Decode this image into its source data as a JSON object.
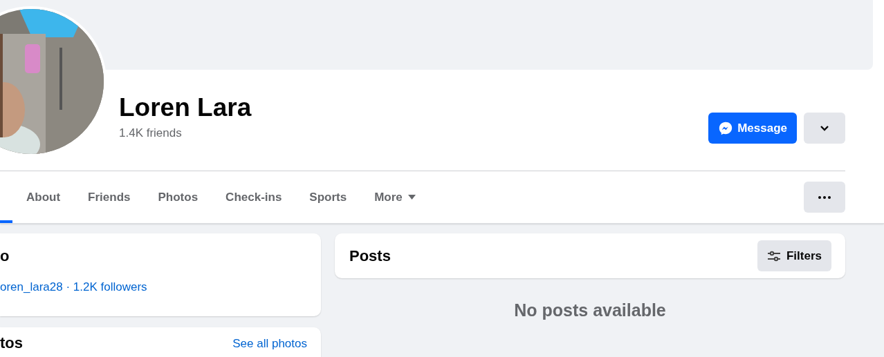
{
  "profile": {
    "name": "Loren Lara",
    "friends": "1.4K friends"
  },
  "actions": {
    "message": "Message"
  },
  "nav": {
    "hidden_tab_selected": true,
    "tabs": [
      {
        "label": "About",
        "selected": false
      },
      {
        "label": "Friends",
        "selected": false
      },
      {
        "label": "Photos",
        "selected": false
      },
      {
        "label": "Check-ins",
        "selected": false
      },
      {
        "label": "Sports",
        "selected": false
      },
      {
        "label": "More",
        "selected": false,
        "kind": "menu"
      }
    ]
  },
  "intro": {
    "title": "o",
    "link": "oren_lara28 · 1.2K followers"
  },
  "photos": {
    "title": "tos",
    "link": "See all photos"
  },
  "posts": {
    "title": "Posts",
    "filters": "Filters",
    "empty": "No posts available"
  }
}
